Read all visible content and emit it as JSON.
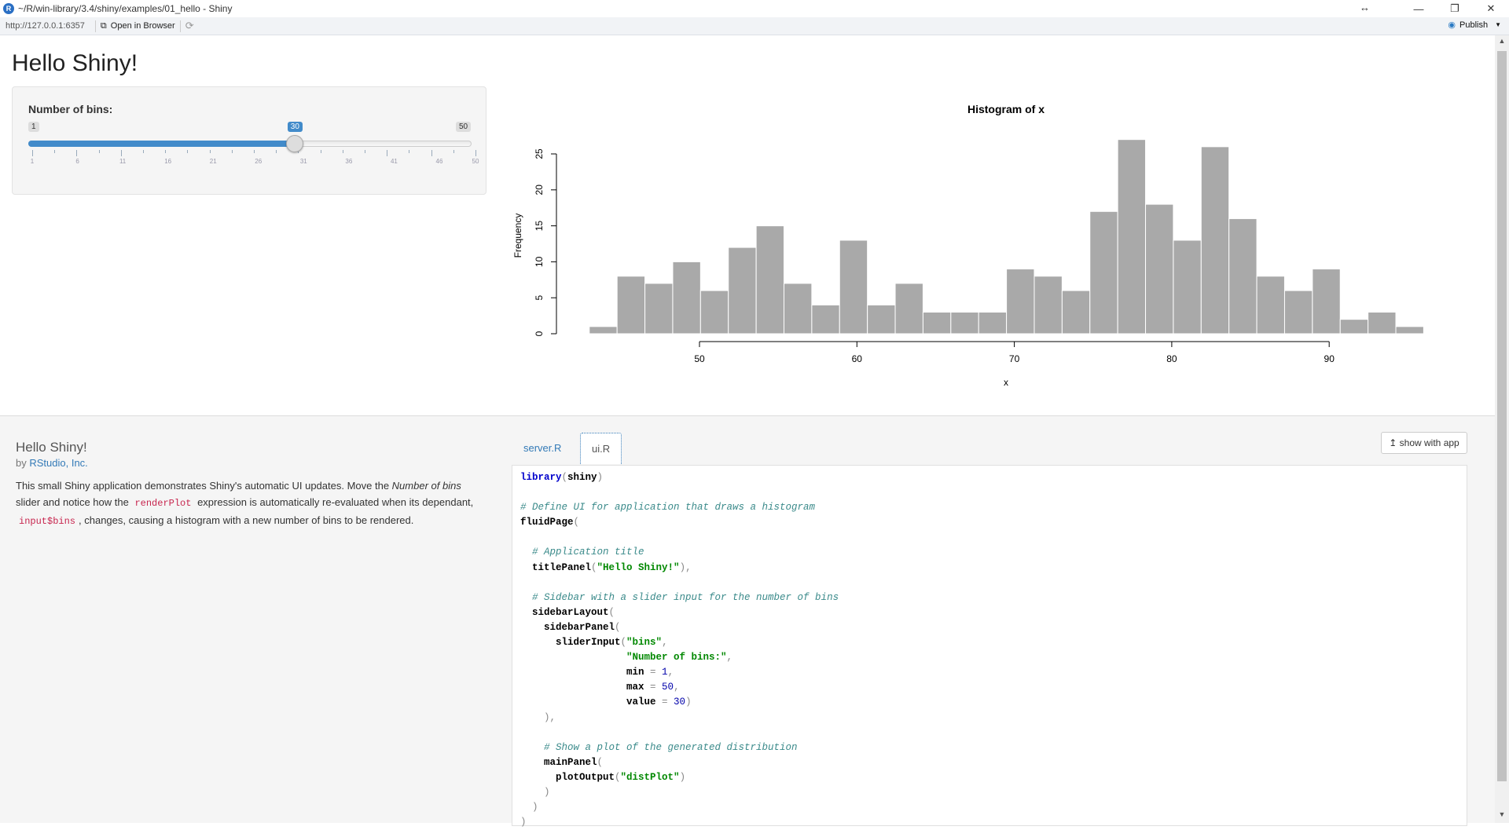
{
  "window": {
    "title": "~/R/win-library/3.4/shiny/examples/01_hello - Shiny",
    "logo": "R"
  },
  "toolbar": {
    "url": "http://127.0.0.1:6357",
    "open_browser": "Open in Browser",
    "publish": "Publish"
  },
  "app": {
    "title": "Hello Shiny!"
  },
  "slider": {
    "label": "Number of bins:",
    "min": 1,
    "max": 50,
    "value": 30,
    "min_label": "1",
    "max_label": "50",
    "value_label": "30",
    "ticks": [
      "1",
      "6",
      "11",
      "16",
      "21",
      "26",
      "31",
      "36",
      "41",
      "46",
      "50"
    ],
    "accent": "#428bca"
  },
  "chart_data": {
    "type": "bar",
    "title": "Histogram of x",
    "xlabel": "x",
    "ylabel": "Frequency",
    "bin_start": 43,
    "bin_width": 1.7667,
    "values": [
      1,
      8,
      7,
      10,
      6,
      12,
      15,
      7,
      4,
      13,
      4,
      7,
      3,
      3,
      3,
      9,
      8,
      6,
      17,
      27,
      18,
      13,
      26,
      16,
      8,
      6,
      9,
      2,
      3,
      1
    ],
    "xticks": [
      50,
      60,
      70,
      80,
      90
    ],
    "yticks": [
      0,
      5,
      10,
      15,
      20,
      25
    ],
    "xlim": [
      43,
      96
    ],
    "ylim": [
      0,
      27
    ],
    "bar_color": "#a9a9a9"
  },
  "info": {
    "title": "Hello Shiny!",
    "by": "by",
    "author": "RStudio, Inc.",
    "desc": [
      "This small Shiny application demonstrates Shiny's automatic UI updates. Move the ",
      "Number of bins",
      " slider and notice how the ",
      "renderPlot",
      " expression is automatically re-evaluated when its dependant, ",
      "input$bins",
      ", changes, causing a histogram with a new number of bins to be rendered."
    ]
  },
  "tabs": [
    {
      "label": "server.R"
    },
    {
      "label": "ui.R"
    }
  ],
  "show_with_app": "show with app",
  "code": [
    [
      [
        "fn",
        "library"
      ],
      [
        "p",
        "("
      ],
      [
        "id",
        "shiny"
      ],
      [
        "p",
        ")"
      ]
    ],
    [],
    [
      [
        "c",
        "# Define UI for application that draws a histogram"
      ]
    ],
    [
      [
        "id",
        "fluidPage"
      ],
      [
        "p",
        "("
      ]
    ],
    [],
    [
      [
        "c",
        "  # Application title"
      ]
    ],
    [
      [
        "id",
        "  titlePanel"
      ],
      [
        "p",
        "("
      ],
      [
        "s",
        "\"Hello Shiny!\""
      ],
      [
        "p",
        "),"
      ]
    ],
    [],
    [
      [
        "c",
        "  # Sidebar with a slider input for the number of bins"
      ]
    ],
    [
      [
        "id",
        "  sidebarLayout"
      ],
      [
        "p",
        "("
      ]
    ],
    [
      [
        "id",
        "    sidebarPanel"
      ],
      [
        "p",
        "("
      ]
    ],
    [
      [
        "id",
        "      sliderInput"
      ],
      [
        "p",
        "("
      ],
      [
        "s",
        "\"bins\""
      ],
      [
        "p",
        ","
      ]
    ],
    [
      [
        "s",
        "                  \"Number of bins:\""
      ],
      [
        "p",
        ","
      ]
    ],
    [
      [
        "id",
        "                  min "
      ],
      [
        "o",
        "="
      ],
      [
        "n",
        " 1"
      ],
      [
        "p",
        ","
      ]
    ],
    [
      [
        "id",
        "                  max "
      ],
      [
        "o",
        "="
      ],
      [
        "n",
        " 50"
      ],
      [
        "p",
        ","
      ]
    ],
    [
      [
        "id",
        "                  value "
      ],
      [
        "o",
        "="
      ],
      [
        "n",
        " 30"
      ],
      [
        "p",
        ")"
      ]
    ],
    [
      [
        "p",
        "    ),"
      ]
    ],
    [],
    [
      [
        "c",
        "    # Show a plot of the generated distribution"
      ]
    ],
    [
      [
        "id",
        "    mainPanel"
      ],
      [
        "p",
        "("
      ]
    ],
    [
      [
        "id",
        "      plotOutput"
      ],
      [
        "p",
        "("
      ],
      [
        "s",
        "\"distPlot\""
      ],
      [
        "p",
        ")"
      ]
    ],
    [
      [
        "p",
        "    )"
      ]
    ],
    [
      [
        "p",
        "  )"
      ]
    ],
    [
      [
        "p",
        ")"
      ]
    ]
  ]
}
